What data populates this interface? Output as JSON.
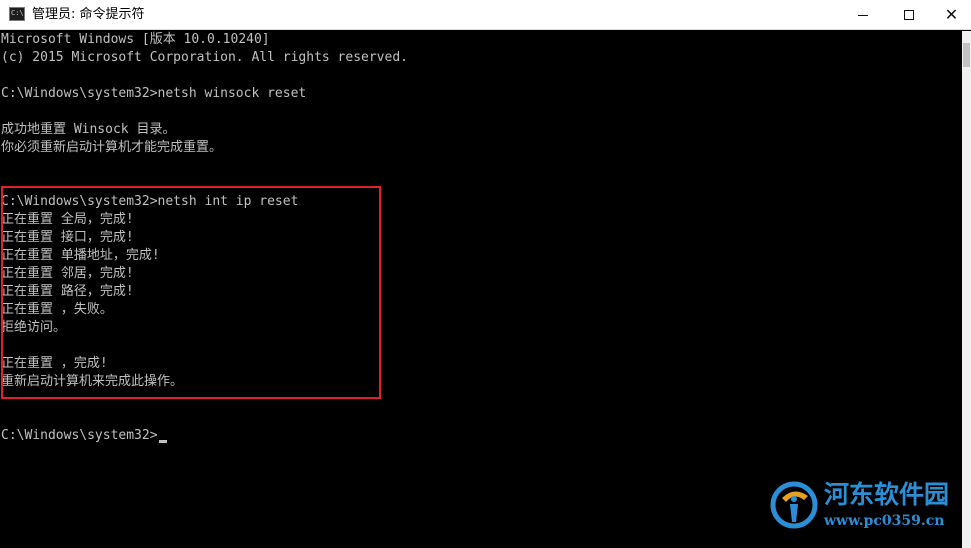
{
  "window": {
    "title": "管理员: 命令提示符",
    "icon": "cmd-icon",
    "controls": {
      "minimize_icon": "minimize-icon",
      "maximize_icon": "maximize-icon",
      "close": "✕"
    }
  },
  "console": {
    "lines": [
      "Microsoft Windows [版本 10.0.10240]",
      "(c) 2015 Microsoft Corporation. All rights reserved.",
      "",
      "C:\\Windows\\system32>netsh winsock reset",
      "",
      "成功地重置 Winsock 目录。",
      "你必须重新启动计算机才能完成重置。",
      "",
      "",
      "C:\\Windows\\system32>netsh int ip reset",
      "正在重置 全局，完成!",
      "正在重置 接口，完成!",
      "正在重置 单播地址，完成!",
      "正在重置 邻居，完成!",
      "正在重置 路径，完成!",
      "正在重置 ，失败。",
      "拒绝访问。",
      "",
      "正在重置 ，完成!",
      "重新启动计算机来完成此操作。",
      "",
      "",
      "C:\\Windows\\system32>"
    ],
    "text_color": "#c0c0c0",
    "background_color": "#000000",
    "highlight_color": "#e0202a"
  },
  "watermark": {
    "title": "河东软件园",
    "url": "www.pc0359.cn",
    "color": "#2a8fd6"
  }
}
